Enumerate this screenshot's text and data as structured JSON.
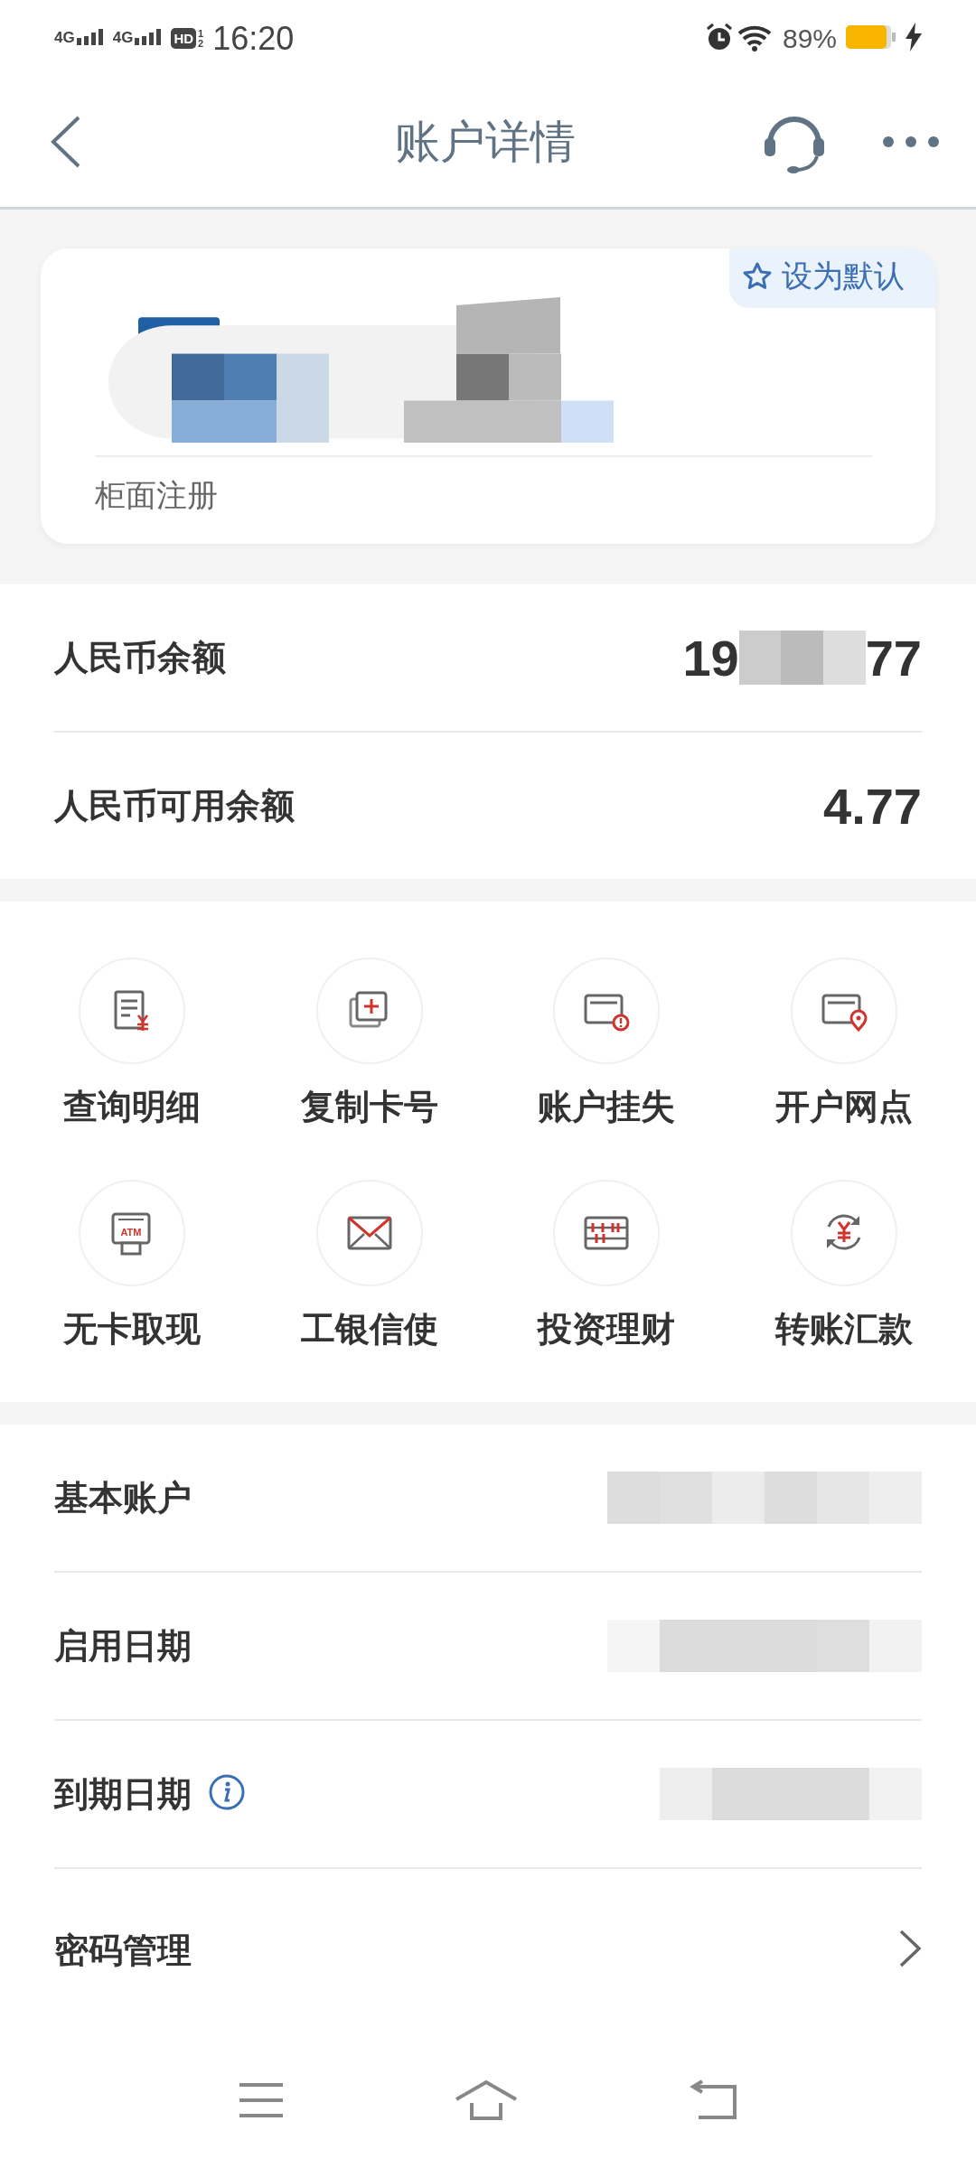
{
  "status_bar": {
    "networks": [
      "4G",
      "4G"
    ],
    "hd_label": "HD",
    "sim_marks": [
      "1",
      "2"
    ],
    "time": "16:20",
    "battery": "89%",
    "charging": true
  },
  "header": {
    "title": "账户详情"
  },
  "card": {
    "default_button": "设为默认",
    "registration": "柜面注册"
  },
  "balances": [
    {
      "label": "人民币余额",
      "kind": "masked",
      "value_head": "19",
      "value_tail": "77"
    },
    {
      "label": "人民币可用余额",
      "kind": "plain",
      "value": "4.77"
    }
  ],
  "actions": [
    {
      "label": "查询明细",
      "kind": "statement"
    },
    {
      "label": "复制卡号",
      "kind": "copy"
    },
    {
      "label": "账户挂失",
      "kind": "card_alert"
    },
    {
      "label": "开户网点",
      "kind": "card_location"
    },
    {
      "label": "无卡取现",
      "kind": "atm",
      "icon_text": "ATM"
    },
    {
      "label": "工银信使",
      "kind": "mail"
    },
    {
      "label": "投资理财",
      "kind": "abacus"
    },
    {
      "label": "转账汇款",
      "kind": "transfer"
    }
  ],
  "details": [
    {
      "label": "基本账户",
      "info": false,
      "masked": true,
      "chevron": false
    },
    {
      "label": "启用日期",
      "info": false,
      "masked": true,
      "chevron": false
    },
    {
      "label": "到期日期",
      "info": true,
      "masked": true,
      "chevron": false
    },
    {
      "label": "密码管理",
      "info": false,
      "masked": false,
      "chevron": true
    }
  ]
}
